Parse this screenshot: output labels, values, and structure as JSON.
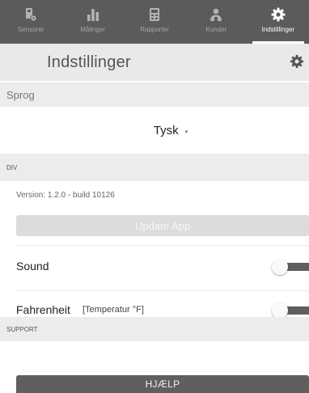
{
  "tabs": [
    {
      "label": "Sensorer",
      "icon": "sensor-icon",
      "active": false
    },
    {
      "label": "Målinger",
      "icon": "bar-chart-icon",
      "active": false
    },
    {
      "label": "Rapporter",
      "icon": "report-icon",
      "active": false
    },
    {
      "label": "Kunder",
      "icon": "customers-icon",
      "active": false
    },
    {
      "label": "Indstillinger",
      "icon": "gear-icon",
      "active": true
    }
  ],
  "header": {
    "title": "Indstillinger",
    "icon": "gear-icon"
  },
  "language": {
    "section_label": "Sprog",
    "value": "Tysk",
    "caret": "▾"
  },
  "misc": {
    "section_label": "DIV",
    "version": "Version: 1.2.0 - build 10126",
    "update_label": "Update App",
    "sound_label": "Sound",
    "sound_on": false,
    "fahrenheit_label": "Fahrenheit",
    "fahrenheit_sub": "[Temperatur °F]",
    "fahrenheit_on": false
  },
  "support": {
    "section_label": "SUPPORT",
    "help_label": "HJÆLP"
  },
  "colors": {
    "tabbar": "#5b5b5b",
    "header": "#e9e9e9",
    "toggle_track": "#5e5e5e",
    "help_button": "#5f5f5f"
  }
}
